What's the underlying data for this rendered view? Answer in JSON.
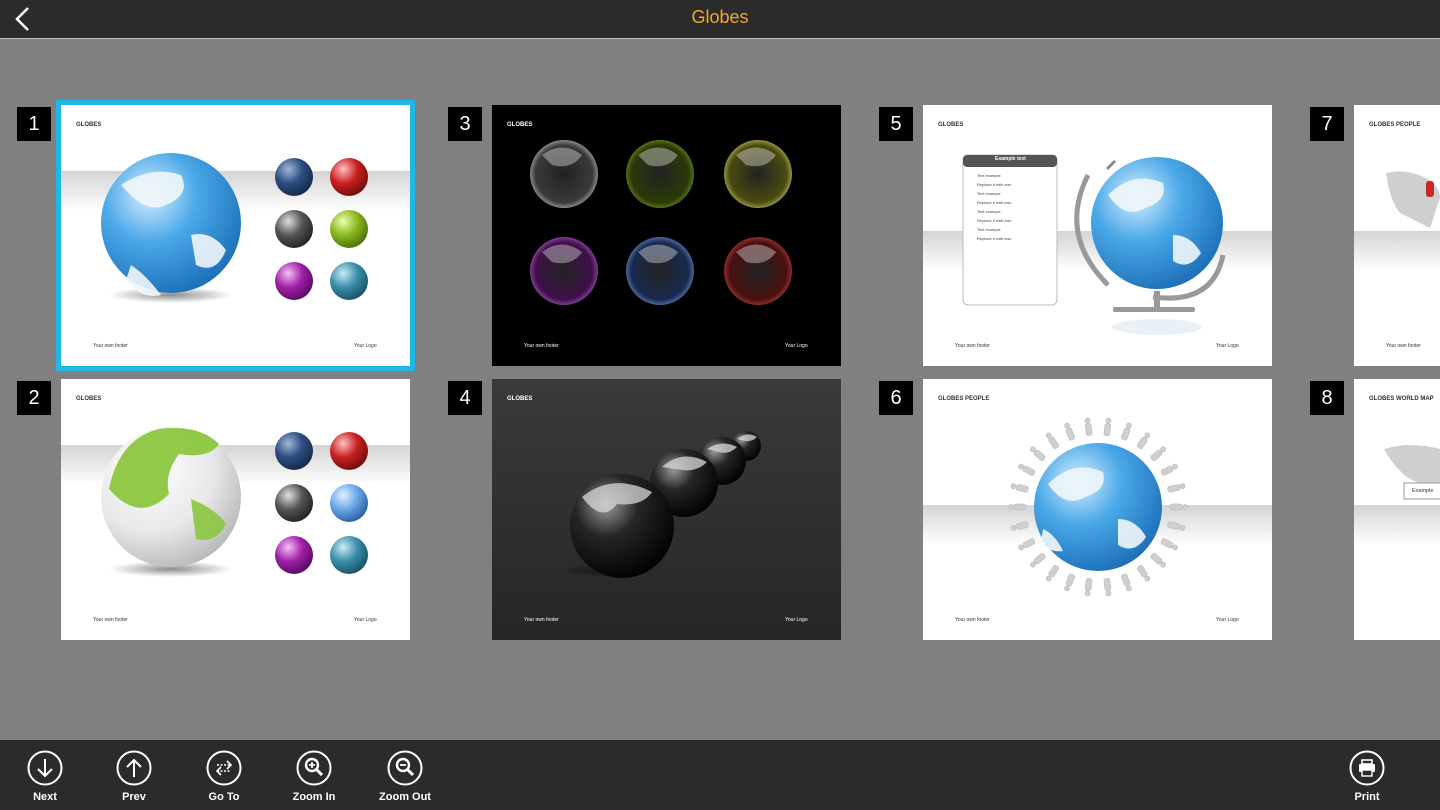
{
  "header": {
    "title": "Globes",
    "back_icon": "back-arrow-icon"
  },
  "slides": [
    {
      "number": "1",
      "title": "GLOBES",
      "footer_left": "Your own footer",
      "footer_right": "Your Logo",
      "selected": true
    },
    {
      "number": "2",
      "title": "GLOBES",
      "footer_left": "Your own footer",
      "footer_right": "Your Logo"
    },
    {
      "number": "3",
      "title": "GLOBES",
      "footer_left": "Your own footer",
      "footer_right": "Your Logo"
    },
    {
      "number": "4",
      "title": "GLOBES",
      "footer_left": "Your own footer",
      "footer_right": "Your Logo"
    },
    {
      "number": "5",
      "title": "GLOBES",
      "footer_left": "Your own footer",
      "footer_right": "Your Logo",
      "box_title": "Example text",
      "box_items": [
        "Text example",
        "Replace it with own",
        "Text example",
        "Replace it with own",
        "Text example",
        "Replace it with own",
        "Text example",
        "Replace it with own"
      ]
    },
    {
      "number": "6",
      "title": "GLOBES PEOPLE",
      "footer_left": "Your own footer",
      "footer_right": "Your Logo"
    },
    {
      "number": "7",
      "title": "GLOBES PEOPLE",
      "footer_left": "Your own footer"
    },
    {
      "number": "8",
      "title": "GLOBES WORLD MAP",
      "callout": "Example"
    }
  ],
  "toolbar": {
    "next": "Next",
    "prev": "Prev",
    "goto": "Go To",
    "zoom_in": "Zoom In",
    "zoom_out": "Zoom Out",
    "print": "Print"
  },
  "colors": {
    "accent": "#f5a623",
    "selection": "#1fb6e8",
    "bar": "#2b2b2b",
    "canvas": "#808080"
  }
}
